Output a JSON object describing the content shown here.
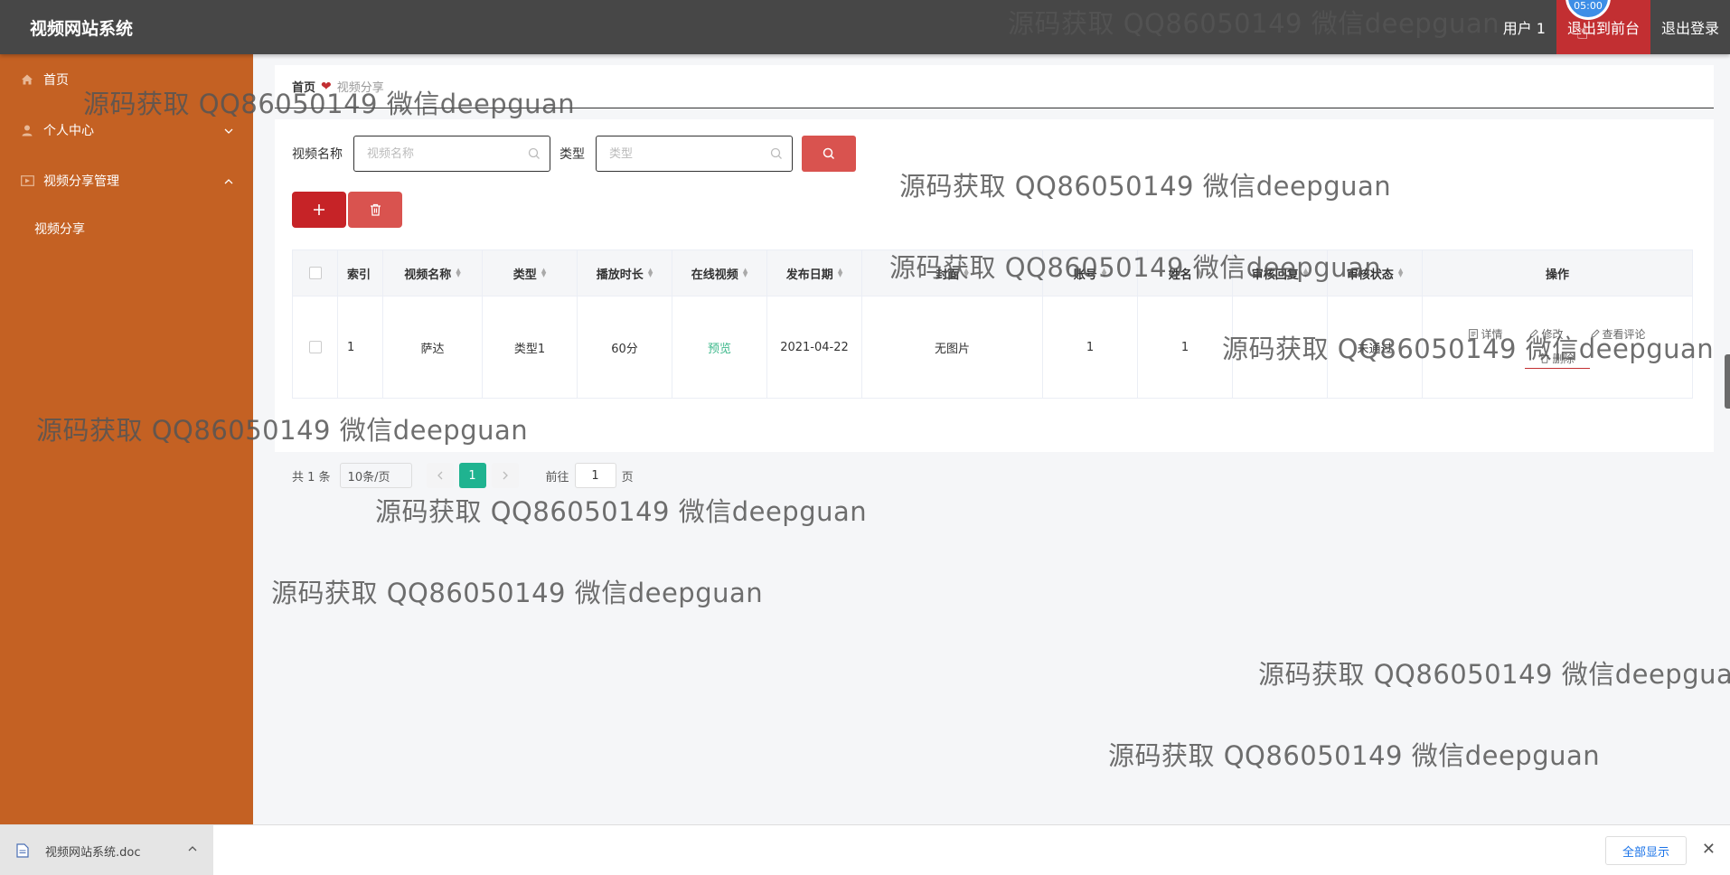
{
  "app": {
    "title": "视频网站系统"
  },
  "topbar": {
    "user": "用户 1",
    "front_label": "退出到前台",
    "logout_label": "退出登录",
    "time_badge": "05:00"
  },
  "sidebar": {
    "items": [
      {
        "label": "首页",
        "icon": "home-icon"
      },
      {
        "label": "个人中心",
        "icon": "user-icon",
        "chevron": "down"
      },
      {
        "label": "视频分享管理",
        "icon": "video-icon",
        "chevron": "up"
      }
    ],
    "sub_items": [
      {
        "label": "视频分享"
      }
    ]
  },
  "breadcrumb": {
    "home": "首页",
    "current": "视频分享"
  },
  "search": {
    "name_label": "视频名称",
    "name_placeholder": "视频名称",
    "type_label": "类型",
    "type_placeholder": "类型"
  },
  "table": {
    "headers": [
      "索引",
      "视频名称",
      "类型",
      "播放时长",
      "在线视频",
      "发布日期",
      "封面",
      "账号",
      "姓名",
      "审核回复",
      "审核状态",
      "操作"
    ],
    "rows": [
      {
        "index": "1",
        "name": "萨达",
        "type": "类型1",
        "duration": "60分",
        "online": "预览",
        "date": "2021-04-22",
        "cover": "无图片",
        "account": "1",
        "realname": "1",
        "reply": "",
        "status": "未通过"
      }
    ],
    "ops": {
      "detail": "详情",
      "edit": "修改",
      "comments": "查看评论",
      "delete": "删除"
    }
  },
  "pagination": {
    "total": "共 1 条",
    "page_size": "10条/页",
    "current_page": "1",
    "goto_prefix": "前往",
    "goto_value": "1",
    "goto_suffix": "页"
  },
  "download": {
    "file": "视频网站系统.doc",
    "show_all": "全部显示"
  },
  "watermark": {
    "text": "源码获取 QQ86050149 微信deepguan"
  },
  "colors": {
    "topbar": "#474747",
    "sidebar": "#c46123",
    "accent_red": "#c22f32",
    "page_green": "#1fb390"
  }
}
